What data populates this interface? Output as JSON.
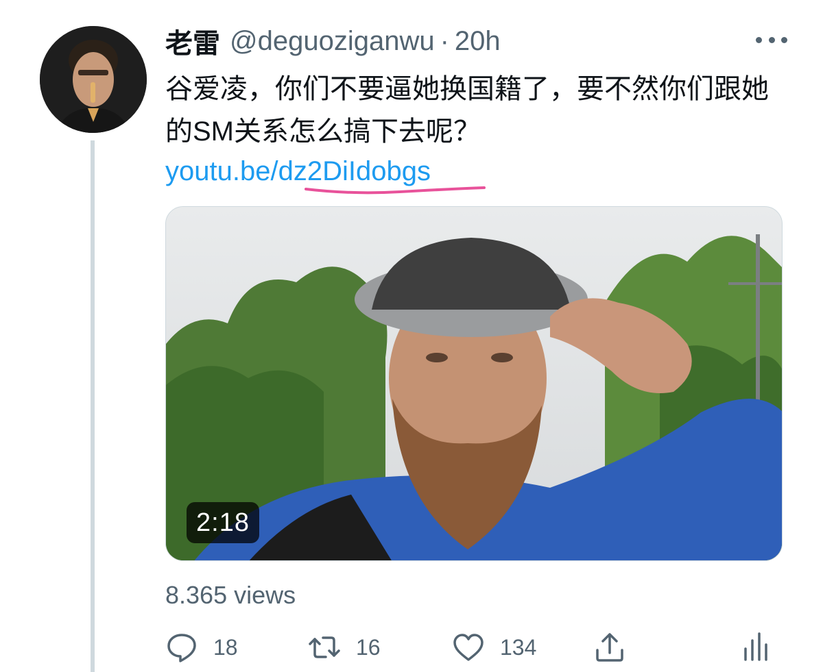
{
  "tweet": {
    "display_name": "老雷",
    "handle": "@deguoziganwu",
    "separator": "·",
    "time": "20h",
    "text": "谷爱凌，你们不要逼她换国籍了，要不然你们跟她的SM关系怎么搞下去呢？",
    "link_prefix": "youtu.be/",
    "link_highlight": "dz2DiIdobgs",
    "underline_color": "#e8529a"
  },
  "media": {
    "type": "video",
    "duration": "2:18"
  },
  "stats": {
    "views": "8.365 views"
  },
  "actions": {
    "reply_count": "18",
    "retweet_count": "16",
    "like_count": "134"
  },
  "icons": {
    "avatar": "avatar",
    "more": "more-icon",
    "reply": "reply-icon",
    "retweet": "retweet-icon",
    "like": "like-icon",
    "share": "share-icon",
    "analytics": "analytics-icon"
  },
  "colors": {
    "text": "#0f1419",
    "secondary": "#536471",
    "link": "#1d9bf0",
    "divider": "#cfd9de"
  }
}
